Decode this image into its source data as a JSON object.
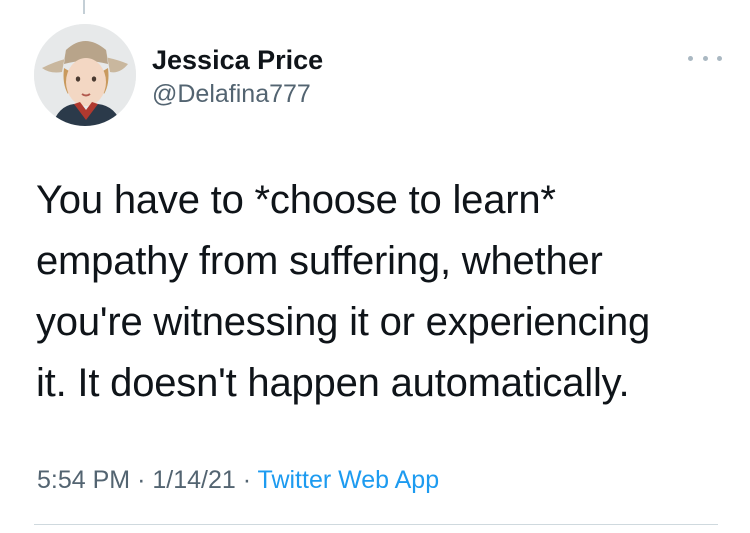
{
  "author": {
    "display_name": "Jessica Price",
    "handle": "@Delafina777"
  },
  "tweet": {
    "lines": [
      "You have to *choose to learn*",
      "empathy from suffering, whether",
      "you're witnessing it or experiencing",
      "it. It doesn't happen automatically."
    ]
  },
  "meta": {
    "time": "5:54 PM",
    "separator": "·",
    "date": "1/14/21",
    "source": "Twitter Web App"
  },
  "icons": {
    "more": "more-options-icon"
  },
  "colors": {
    "link": "#1d9bf0",
    "secondary_text": "#536471",
    "primary_text": "#0f1419"
  }
}
